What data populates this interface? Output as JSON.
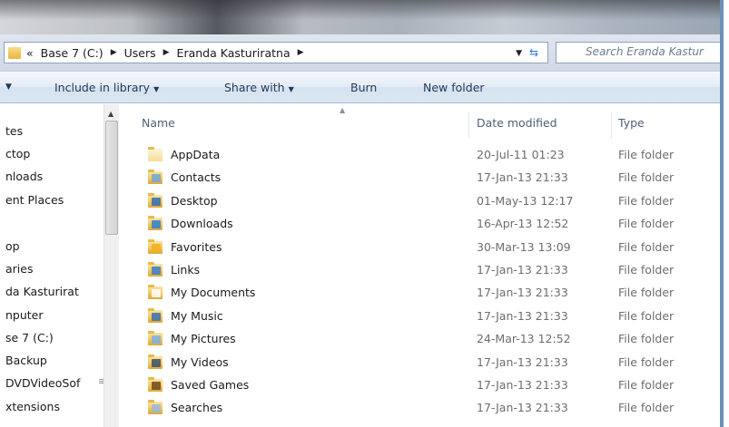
{
  "address": {
    "overflow": "«",
    "crumbs": [
      "Base 7 (C:)",
      "Users",
      "Eranda Kasturiratna"
    ],
    "search_placeholder": "Search Eranda Kastur"
  },
  "commandbar": {
    "include_label": "Include in library",
    "share_label": "Share with",
    "burn_label": "Burn",
    "newfolder_label": "New folder"
  },
  "nav": {
    "items": [
      "tes",
      "ctop",
      "nloads",
      "ent Places",
      "op",
      "aries",
      "da Kasturirat",
      "nputer",
      "se 7 (C:)",
      "Backup",
      "DVDVideoSof",
      "xtensions"
    ]
  },
  "columns": {
    "name": "Name",
    "date": "Date modified",
    "type": "Type"
  },
  "rows": [
    {
      "name": "AppData",
      "date": "20-Jul-11 01:23",
      "type": "File folder",
      "icon": "appdata-folder-icon"
    },
    {
      "name": "Contacts",
      "date": "17-Jan-13 21:33",
      "type": "File folder",
      "icon": "contacts-folder-icon"
    },
    {
      "name": "Desktop",
      "date": "01-May-13 12:17",
      "type": "File folder",
      "icon": "desktop-folder-icon"
    },
    {
      "name": "Downloads",
      "date": "16-Apr-13 12:52",
      "type": "File folder",
      "icon": "downloads-folder-icon"
    },
    {
      "name": "Favorites",
      "date": "30-Mar-13 13:09",
      "type": "File folder",
      "icon": "favorites-folder-icon"
    },
    {
      "name": "Links",
      "date": "17-Jan-13 21:33",
      "type": "File folder",
      "icon": "links-folder-icon"
    },
    {
      "name": "My Documents",
      "date": "17-Jan-13 21:33",
      "type": "File folder",
      "icon": "documents-folder-icon"
    },
    {
      "name": "My Music",
      "date": "17-Jan-13 21:33",
      "type": "File folder",
      "icon": "music-folder-icon"
    },
    {
      "name": "My Pictures",
      "date": "24-Mar-13 12:52",
      "type": "File folder",
      "icon": "pictures-folder-icon"
    },
    {
      "name": "My Videos",
      "date": "17-Jan-13 21:33",
      "type": "File folder",
      "icon": "videos-folder-icon"
    },
    {
      "name": "Saved Games",
      "date": "17-Jan-13 21:33",
      "type": "File folder",
      "icon": "savedgames-folder-icon"
    },
    {
      "name": "Searches",
      "date": "17-Jan-13 21:33",
      "type": "File folder",
      "icon": "searches-folder-icon"
    }
  ],
  "colors": {
    "accent": "#1e395b",
    "glass": "#55595f",
    "folder": "#f2c760"
  }
}
